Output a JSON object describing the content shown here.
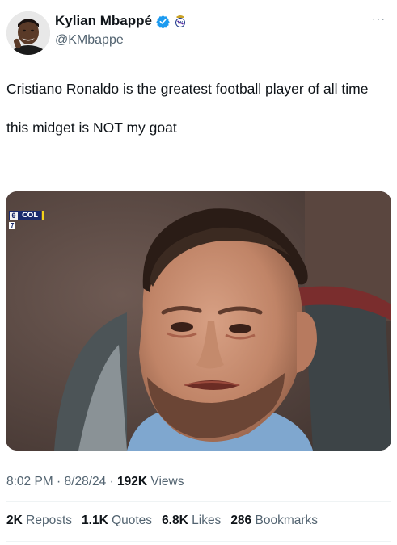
{
  "author": {
    "display_name": "Kylian Mbappé",
    "handle": "@KMbappe",
    "avatar_icon": "profile-photo",
    "verified_icon": "verified-badge-icon",
    "affiliate_icon": "club-crest-icon",
    "verified_color": "#1d9bf0"
  },
  "menu": {
    "more_icon": "more-horizontal-icon",
    "more_glyph": "···"
  },
  "tweet": {
    "line1": "Cristiano Ronaldo is the greatest football player of all time",
    "line2": "this midget is NOT my goat"
  },
  "media": {
    "scorebug": {
      "score": "0",
      "team": "COL",
      "clock": "7"
    }
  },
  "meta": {
    "time": "8:02 PM",
    "date": "8/28/24",
    "separator": "·",
    "views_count": "192K",
    "views_label": "Views"
  },
  "stats": [
    {
      "count": "2K",
      "label": "Reposts"
    },
    {
      "count": "1.1K",
      "label": "Quotes"
    },
    {
      "count": "6.8K",
      "label": "Likes"
    },
    {
      "count": "286",
      "label": "Bookmarks"
    }
  ],
  "colors": {
    "text": "#0f1419",
    "secondary": "#536471",
    "divider": "#eff3f4"
  }
}
